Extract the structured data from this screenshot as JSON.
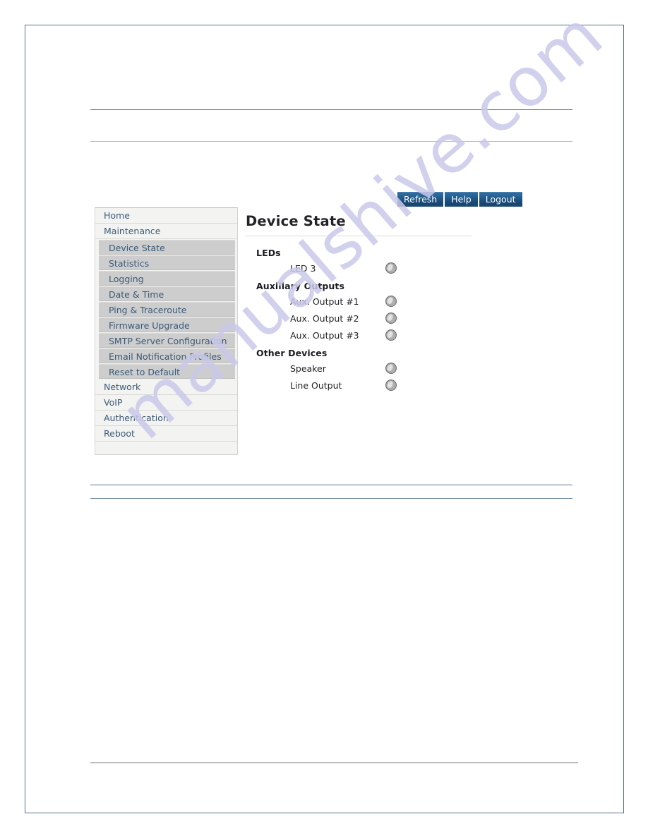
{
  "page": {
    "border_color": "#54708c",
    "background": "#ffffff"
  },
  "watermark": {
    "text": "manualshive.com",
    "color": "#c9c9ea"
  },
  "rules": [
    {
      "name": "rule-top-1",
      "style": "dark"
    },
    {
      "name": "rule-top-2",
      "style": "light"
    },
    {
      "name": "rule-mid-1",
      "style": "dark"
    },
    {
      "name": "rule-mid-2",
      "style": "dark"
    },
    {
      "name": "rule-bottom",
      "style": "gray"
    }
  ],
  "toolbar": {
    "refresh_label": "Refresh",
    "help_label": "Help",
    "logout_label": "Logout",
    "button_color": "#1d5281"
  },
  "sidebar": {
    "items": [
      {
        "label": "Home",
        "level": "top"
      },
      {
        "label": "Maintenance",
        "level": "top"
      },
      {
        "label": "Device State",
        "level": "sub"
      },
      {
        "label": "Statistics",
        "level": "sub"
      },
      {
        "label": "Logging",
        "level": "sub"
      },
      {
        "label": "Date & Time",
        "level": "sub"
      },
      {
        "label": "Ping & Traceroute",
        "level": "sub"
      },
      {
        "label": "Firmware Upgrade",
        "level": "sub"
      },
      {
        "label": "SMTP Server Configuration",
        "level": "sub"
      },
      {
        "label": "Email Notification Profiles",
        "level": "sub"
      },
      {
        "label": "Reset to Default",
        "level": "sub"
      },
      {
        "label": "Network",
        "level": "top"
      },
      {
        "label": "VoIP",
        "level": "top"
      },
      {
        "label": "Authentication",
        "level": "top"
      },
      {
        "label": "Reboot",
        "level": "top"
      }
    ]
  },
  "main": {
    "title": "Device State",
    "groups": [
      {
        "title": "LEDs",
        "rows": [
          {
            "label": "LED 3",
            "indicator": "led-off"
          }
        ]
      },
      {
        "title": "Auxiliary Outputs",
        "rows": [
          {
            "label": "Aux. Output #1",
            "indicator": "led-off"
          },
          {
            "label": "Aux. Output #2",
            "indicator": "led-off"
          },
          {
            "label": "Aux. Output #3",
            "indicator": "led-off"
          }
        ]
      },
      {
        "title": "Other Devices",
        "rows": [
          {
            "label": "Speaker",
            "indicator": "led-off"
          },
          {
            "label": "Line Output",
            "indicator": "led-off"
          }
        ]
      }
    ]
  }
}
